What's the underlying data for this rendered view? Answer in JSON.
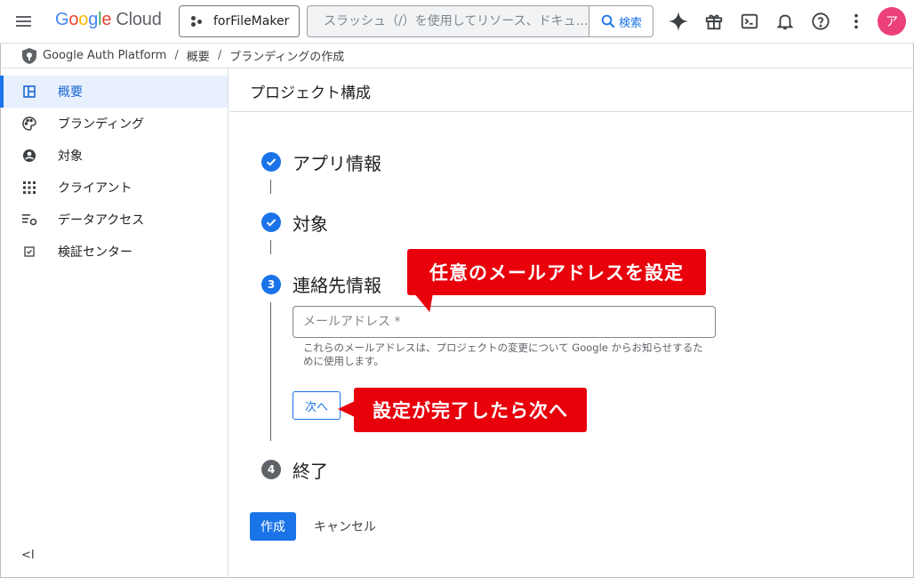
{
  "header": {
    "logo_letters": [
      "G",
      "o",
      "o",
      "g",
      "l",
      "e"
    ],
    "logo_cloud": "Cloud",
    "project_name": "forFileMaker",
    "search_placeholder": "スラッシュ（/）を使用してリソース、ドキュ…",
    "search_button": "検索",
    "avatar_initial": "ア",
    "icons": [
      "menu-icon",
      "gemini-sparkle-icon",
      "gift-icon",
      "cloud-shell-icon",
      "notifications-icon",
      "help-icon",
      "more-vert-icon"
    ]
  },
  "breadcrumb": {
    "items": [
      "Google Auth Platform",
      "概要",
      "ブランディングの作成"
    ],
    "separator": "/"
  },
  "sidebar": {
    "items": [
      {
        "label": "概要",
        "icon": "dashboard-icon",
        "active": true
      },
      {
        "label": "ブランディング",
        "icon": "palette-icon",
        "active": false
      },
      {
        "label": "対象",
        "icon": "account-circle-icon",
        "active": false
      },
      {
        "label": "クライアント",
        "icon": "apps-grid-icon",
        "active": false
      },
      {
        "label": "データアクセス",
        "icon": "data-access-icon",
        "active": false
      },
      {
        "label": "検証センター",
        "icon": "verification-icon",
        "active": false
      }
    ],
    "collapse_label": "<I"
  },
  "main": {
    "title": "プロジェクト構成",
    "steps": [
      {
        "number": "1",
        "label": "アプリ情報",
        "status": "complete"
      },
      {
        "number": "2",
        "label": "対象",
        "status": "complete"
      },
      {
        "number": "3",
        "label": "連絡先情報",
        "status": "current"
      },
      {
        "number": "4",
        "label": "終了",
        "status": "pending"
      }
    ],
    "email_placeholder": "メールアドレス *",
    "email_hint": "これらのメールアドレスは、プロジェクトの変更について Google からお知らせするために使用します。",
    "next_button": "次へ",
    "create_button": "作成",
    "cancel_button": "キャンセル"
  },
  "annotations": {
    "callout_email": "任意のメールアドレスを設定",
    "callout_next": "設定が完了したら次へ",
    "color": "#e8000b"
  },
  "colors": {
    "accent": "#1a73e8",
    "active_bg": "#e8f0fe",
    "step_pending": "#5f6368"
  }
}
